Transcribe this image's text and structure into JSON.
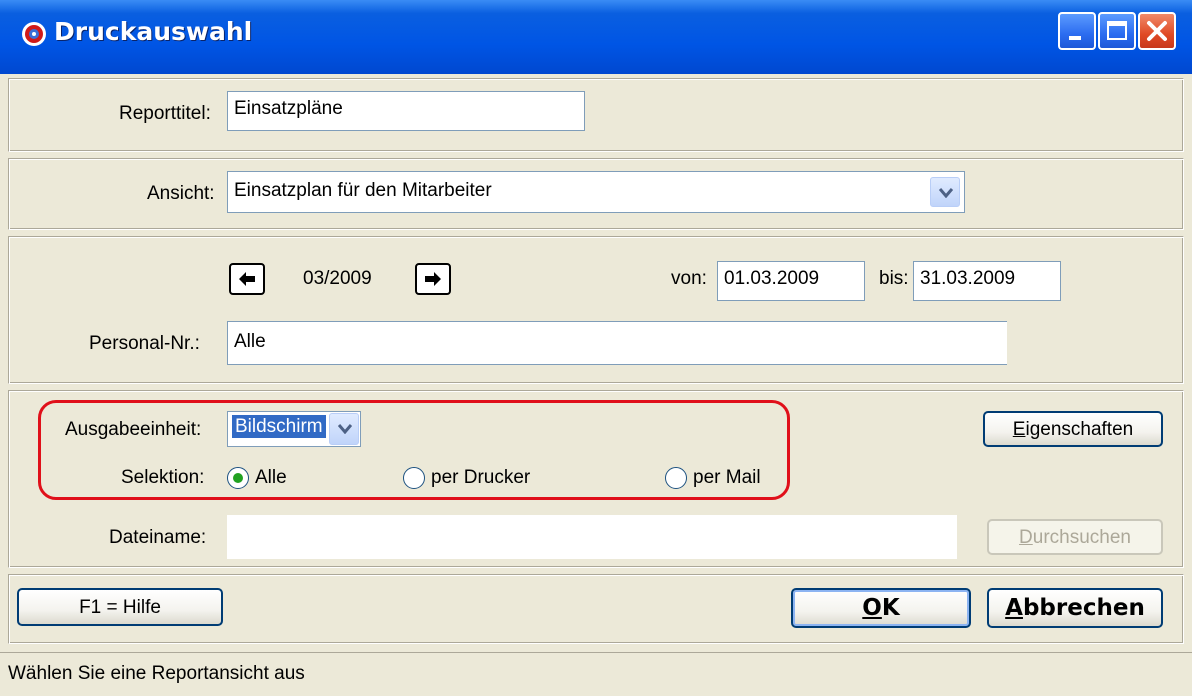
{
  "window": {
    "title": "Druckauswahl",
    "controls": [
      "minimize-icon",
      "maximize-icon",
      "close-icon"
    ],
    "accent": "#0055E5"
  },
  "report": {
    "label": "Reporttitel:",
    "value": "Einsatzpläne"
  },
  "view": {
    "label": "Ansicht:",
    "selected": "Einsatzplan für den Mitarbeiter"
  },
  "period": {
    "month": "03/2009",
    "from_label": "von:",
    "from_value": "01.03.2009",
    "to_label": "bis:",
    "to_value": "31.03.2009",
    "personnel_label": "Personal-Nr.:",
    "personnel_value": "Alle",
    "prev_icon": "arrow-left-icon",
    "next_icon": "arrow-right-icon"
  },
  "output": {
    "unit_label": "Ausgabeeinheit:",
    "unit_selected": "Bildschirm",
    "properties_first": "E",
    "properties_rest": "igenschaften",
    "selection_label": "Selektion:",
    "radio_all": "Alle",
    "radio_printer": "per Drucker",
    "radio_mail": "per Mail",
    "selected_radio": "Alle",
    "filename_label": "Dateiname:",
    "filename_value": "",
    "browse_first": "D",
    "browse_rest": "urchsuchen",
    "highlight_color": "#E0101A"
  },
  "footer": {
    "help_label": "F1 = Hilfe",
    "ok_first": "O",
    "ok_rest": "K",
    "cancel_first": "A",
    "cancel_rest": "bbrechen"
  },
  "status": {
    "text": "Wählen Sie eine Reportansicht aus"
  }
}
